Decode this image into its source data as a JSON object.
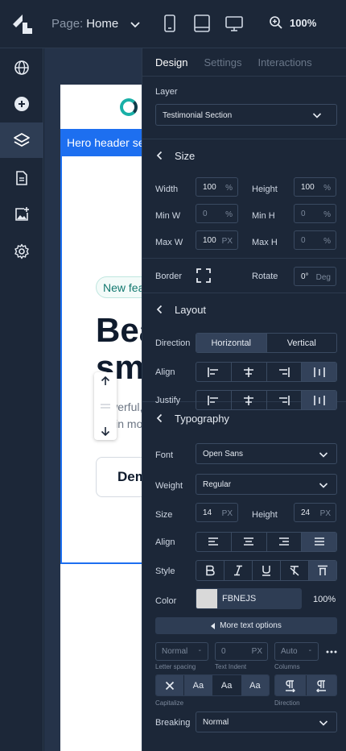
{
  "topbar": {
    "page_prefix": "Page:",
    "page_name": "Home",
    "zoom": "100%"
  },
  "canvas": {
    "hero_tag": "Hero header section",
    "pill": "New feature",
    "headline_1": "Beautiful",
    "headline_2": "smart",
    "sub_1": "Powerful, self-serve",
    "sub_2": "retain more users.",
    "button": "Demo"
  },
  "panel": {
    "tabs": [
      "Design",
      "Settings",
      "Interactions"
    ],
    "layer_label": "Layer",
    "layer_value": "Testimonial Section",
    "size": {
      "title": "Size",
      "width_label": "Width",
      "width_value": "100",
      "width_unit": "%",
      "height_label": "Height",
      "height_value": "100",
      "height_unit": "%",
      "minw_label": "Min W",
      "minw_value": "0",
      "minw_unit": "%",
      "minh_label": "Min H",
      "minh_value": "0",
      "minh_unit": "%",
      "maxw_label": "Max W",
      "maxw_value": "100",
      "maxw_unit": "PX",
      "maxh_label": "Max H",
      "maxh_value": "0",
      "maxh_unit": "%"
    },
    "border_label": "Border",
    "rotate_label": "Rotate",
    "rotate_value": "0°",
    "rotate_unit": "Deg",
    "layout": {
      "title": "Layout",
      "direction_label": "Direction",
      "direction_options": [
        "Horizontal",
        "Vertical"
      ],
      "align_label": "Align",
      "justify_label": "Justify"
    },
    "typography": {
      "title": "Typography",
      "font_label": "Font",
      "font_value": "Open Sans",
      "weight_label": "Weight",
      "weight_value": "Regular",
      "size_label": "Size",
      "size_value": "14",
      "size_unit": "PX",
      "height_label": "Height",
      "height_value": "24",
      "height_unit": "PX",
      "align_label": "Align",
      "style_label": "Style",
      "color_label": "Color",
      "color_hex": "FBNEJS",
      "color_opacity": "100%",
      "color_swatch": "#d9d9d9",
      "more_options": "More text options",
      "letter_spacing_value": "Normal",
      "letter_spacing_label": "Letter spacing",
      "text_indent_value": "0",
      "text_indent_unit": "PX",
      "text_indent_label": "Text Indent",
      "columns_value": "Auto",
      "columns_label": "Columns",
      "capitalize_label": "Capitalize",
      "capitalize_options": [
        "Aa",
        "Aa",
        "Aa"
      ],
      "direction_label": "Direction",
      "breaking_label": "Breaking",
      "breaking_value": "Normal"
    }
  },
  "colors": {
    "accent": "#1d6ff0",
    "panel_bg": "#1c2738",
    "teal": "#19b0a7"
  }
}
